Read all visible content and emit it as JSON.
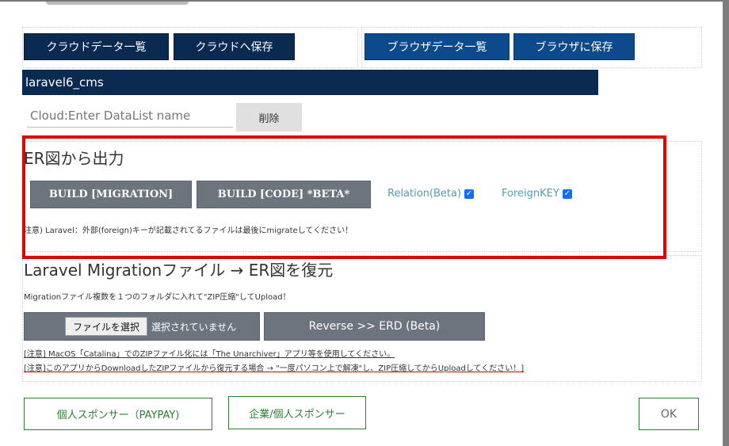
{
  "toolbar": {
    "cloud_list": "クラウドデータ一覧",
    "cloud_save": "クラウドへ保存",
    "browser_list": "ブラウザデータ一覧",
    "browser_save": "ブラウザに保存"
  },
  "project_select": {
    "value": "laravel6_cms"
  },
  "datalist": {
    "placeholder": "Cloud:Enter DataList name",
    "delete_label": "削除"
  },
  "er_output": {
    "heading": "ER図から出力",
    "build_migration": "BUILD [MIGRATION]",
    "build_code": "BUILD [CODE] *BETA*",
    "relation_label": "Relation(Beta)",
    "relation_checked": true,
    "foreignkey_label": "ForeignKEY",
    "foreignkey_checked": true,
    "note": "注意) Laravel：外部(foreign)キーが記載されてるファイルは最後にmigrateしてください！"
  },
  "restore": {
    "heading": "Laravel Migrationファイル → ER図を復元",
    "description": "Migrationファイル複数を１つのフォルダに入れて\"ZIP圧縮\"してUpload！",
    "file_button": "ファイルを選択",
    "file_status": "選択されていません",
    "reverse_button": "Reverse >> ERD (Beta)",
    "note1": "[注意] MacOS「Catalina」でのZIPファイル化には「The Unarchiver」アプリ等を使用してください。",
    "note2": "[注意]このアプリからDownloadしたZIPファイルから復元する場合 → \"一度パソコン上で解凍\"し、ZIP圧縮してからUploadしてください！]"
  },
  "footer": {
    "sponsor_personal": "個人スポンサー（PAYPAY)",
    "sponsor_corp": "企業/個人スポンサー",
    "ok": "OK"
  },
  "colors": {
    "navy": "#0b2a52",
    "blue": "#0d4a8c",
    "gray": "#6c757d",
    "green": "#2e7d32",
    "highlight": "#e00000"
  }
}
